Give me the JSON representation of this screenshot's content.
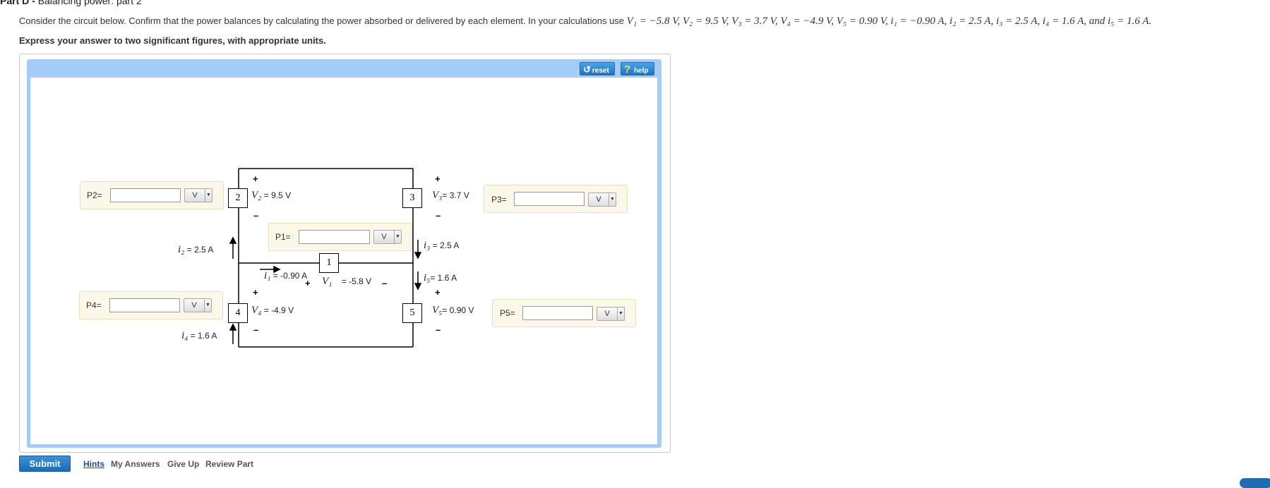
{
  "part": {
    "prefix": "Part D -",
    "title": "Balancing power: part 2"
  },
  "problem": {
    "intro": "Consider the circuit below. Confirm that the power balances by calculating the power absorbed or delivered by each element. In your calculations use",
    "givens": "V₁ = −5.8 V, V₂ = 9.5 V, V₃ = 3.7 V, V₄ = −4.9 V, V₅ = 0.90 V, i₁ = −0.90 A, i₂ = 2.5 A, i₃ = 2.5 A, i₄ = 1.6 A, and i₅ = 1.6 A.",
    "instruction": "Express your answer to two significant figures, with appropriate units."
  },
  "toolbar": {
    "reset_label": "reset",
    "help_label": "help",
    "reset_icon": "refresh-icon",
    "help_icon": "question-icon"
  },
  "answers": {
    "p1": {
      "label": "P1=",
      "value": "",
      "unit": "V"
    },
    "p2": {
      "label": "P2=",
      "value": "",
      "unit": "V"
    },
    "p3": {
      "label": "P3=",
      "value": "",
      "unit": "V"
    },
    "p4": {
      "label": "P4=",
      "value": "",
      "unit": "V"
    },
    "p5": {
      "label": "P5=",
      "value": "",
      "unit": "V"
    }
  },
  "circuit": {
    "nodes": [
      "1",
      "2",
      "3",
      "4",
      "5"
    ],
    "v2": {
      "sym": "V₂",
      "val": "= 9.5 V"
    },
    "v3": {
      "sym": "V₃",
      "val": "= 3.7 V"
    },
    "v1": {
      "sym": "V₁",
      "val": "= -5.8 V"
    },
    "v4": {
      "sym": "V₄",
      "val": "= -4.9 V"
    },
    "v5": {
      "sym": "V₅",
      "val": "= 0.90 V"
    },
    "i1": {
      "sym": "i₁",
      "val": "= -0.90 A"
    },
    "i2": {
      "sym": "i₂",
      "val": "= 2.5 A"
    },
    "i3": {
      "sym": "i₃",
      "val": "= 2.5 A"
    },
    "i4": {
      "sym": "i₄",
      "val": "= 1.6 A"
    },
    "i5": {
      "sym": "i₅",
      "val": "= 1.6 A"
    },
    "plus": "+",
    "minus": "–"
  },
  "footer": {
    "submit_label": "Submit",
    "hints_label": "Hints",
    "my_answers_label": "My Answers",
    "give_up_label": "Give Up",
    "review_part_label": "Review Part"
  },
  "colors": {
    "frame_blue": "#a4ccf6",
    "answer_bg": "#fbf8e9",
    "submit_blue": "#1b6cb8",
    "link_blue": "#1d4f91"
  }
}
